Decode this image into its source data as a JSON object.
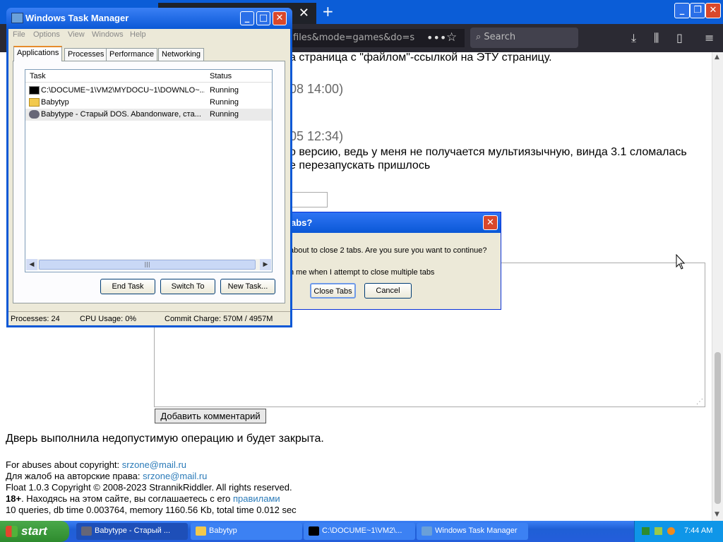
{
  "firefox": {
    "tab_close": "✕",
    "new_tab": "+",
    "window_controls": {
      "minimize": "_",
      "maximize": "❐",
      "close": "✕"
    },
    "url_fragment": "files&mode=games&do=s",
    "page_actions": "•••",
    "bookmark_star": "☆",
    "search_placeholder": "Search",
    "toolbar_icons": {
      "download": "⤓",
      "library": "⫼",
      "sidebar": "▯",
      "menu": "≡"
    }
  },
  "page": {
    "line1": "а страница с \"файлом\"-ссылкой на ЭТУ страницу.",
    "date1": "08 14:00)",
    "date2": "05 12:34)",
    "comment_line1": "о версию, ведь у меня не получается мультиязычную, винда 3.1 сломалась",
    "comment_line2": "е перезапускать пришлось",
    "submit_label": "Добавить комментарий",
    "door_msg": "Дверь выполнила недопустимую операцию и будет закрыта.",
    "abuse_label": "For abuses about copyright:",
    "abuse_email": "srzone@mail.ru",
    "abuse_ru_label": "Для жалоб на авторские права:",
    "abuse_ru_email": "srzone@mail.ru",
    "copyright": "Float 1.0.3 Copyright © 2008-2023 StrannikRiddler. All rights reserved.",
    "age_badge": "18+",
    "age_text": ". Находясь на этом сайте, вы соглашаетесь с его",
    "rules_link": "правилами",
    "stats": "10 queries, db time 0.003764, memory 1160.56 Kb, total time 0.012 sec"
  },
  "dialog": {
    "title": "abs?",
    "close": "✕",
    "message": "about to close 2 tabs. Are you sure you want to continue?",
    "checkbox_label": "n me when I attempt to close multiple tabs",
    "close_tabs": "Close Tabs",
    "cancel": "Cancel"
  },
  "taskmgr": {
    "title": "Windows Task Manager",
    "menu": [
      "File",
      "Options",
      "View",
      "Windows",
      "Help"
    ],
    "tabs": [
      "Applications",
      "Processes",
      "Performance",
      "Networking"
    ],
    "columns": {
      "task": "Task",
      "status": "Status"
    },
    "rows": [
      {
        "task": "C:\\DOCUME~1\\VM2\\MYDOCU~1\\DOWNLO~...",
        "status": "Running",
        "icon": "console-icon"
      },
      {
        "task": "Babytyp",
        "status": "Running",
        "icon": "folder-icon"
      },
      {
        "task": "Babytype - Старый DOS. Abandonware, ста...",
        "status": "Running",
        "icon": "app-icon"
      }
    ],
    "scroll_grip": "|||",
    "buttons": {
      "end_task": "End Task",
      "switch_to": "Switch To",
      "new_task": "New Task..."
    },
    "status": {
      "processes": "Processes: 24",
      "cpu": "CPU Usage: 0%",
      "commit": "Commit Charge: 570M / 4957M"
    }
  },
  "taskbar": {
    "start": "start",
    "tasks": [
      "Babytype - Старый ...",
      "Babytyp",
      "C:\\DOCUME~1\\VM2\\...",
      "Windows Task Manager"
    ],
    "clock": "7:44 AM"
  }
}
